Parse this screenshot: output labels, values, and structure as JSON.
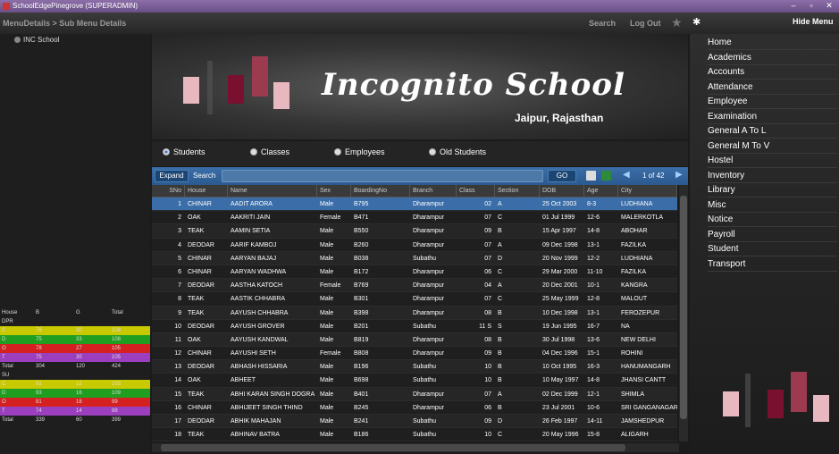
{
  "titlebar": {
    "title": "SchoolEdgePinegrove (SUPERADMIN)",
    "minimize": "–",
    "restore": "▫",
    "close": "✕"
  },
  "topbar": {
    "breadcrumb": "MenuDetails > Sub Menu Details",
    "search": "Search",
    "logout": "Log Out",
    "hide_menu": "Hide Menu"
  },
  "tree": {
    "root": "INC School"
  },
  "stats": {
    "header": [
      "House",
      "B",
      "G",
      "Total"
    ],
    "rows": [
      {
        "c": [
          "DPR",
          "",
          "",
          ""
        ],
        "color": ""
      },
      {
        "c": [
          "C",
          "76",
          "30",
          "106"
        ],
        "color": "#c9c900"
      },
      {
        "c": [
          "D",
          "75",
          "33",
          "108"
        ],
        "color": "#1f9e1f"
      },
      {
        "c": [
          "O",
          "78",
          "27",
          "105"
        ],
        "color": "#d42020"
      },
      {
        "c": [
          "T",
          "75",
          "30",
          "105"
        ],
        "color": "#9b3fbf"
      },
      {
        "c": [
          "Total",
          "304",
          "120",
          "424"
        ],
        "color": ""
      },
      {
        "c": [
          "SU",
          "",
          "",
          ""
        ],
        "color": ""
      },
      {
        "c": [
          "C",
          "91",
          "12",
          "103"
        ],
        "color": "#c9c900"
      },
      {
        "c": [
          "D",
          "93",
          "16",
          "109"
        ],
        "color": "#1f9e1f"
      },
      {
        "c": [
          "O",
          "81",
          "18",
          "99"
        ],
        "color": "#d42020"
      },
      {
        "c": [
          "T",
          "74",
          "14",
          "88"
        ],
        "color": "#9b3fbf"
      },
      {
        "c": [
          "Total",
          "339",
          "60",
          "399"
        ],
        "color": ""
      }
    ]
  },
  "banner": {
    "school_name": "Incognito School",
    "city": "Jaipur, Rajasthan"
  },
  "radios": {
    "students": "Students",
    "classes": "Classes",
    "employees": "Employees",
    "old_students": "Old Students",
    "selected": "students"
  },
  "toolbar": {
    "expand": "Expand",
    "search": "Search",
    "search_value": "",
    "go": "GO",
    "page_info": "1 of 42"
  },
  "grid": {
    "columns": [
      "SNo",
      "House",
      "Name",
      "Sex",
      "BoardingNo",
      "Branch",
      "Class",
      "Section",
      "DOB",
      "Age",
      "City"
    ],
    "rows": [
      [
        "1",
        "CHINAR",
        "AADIT ARORA",
        "Male",
        "B795",
        "Dharampur",
        "02",
        "A",
        "25 Oct 2003",
        "8-3",
        "LUDHIANA"
      ],
      [
        "2",
        "OAK",
        "AAKRITI JAIN",
        "Female",
        "B471",
        "Dharampur",
        "07",
        "C",
        "01 Jul 1999",
        "12-6",
        "MALERKOTLA"
      ],
      [
        "3",
        "TEAK",
        "AAMIN SETIA",
        "Male",
        "B550",
        "Dharampur",
        "09",
        "B",
        "15 Apr 1997",
        "14-8",
        "ABOHAR"
      ],
      [
        "4",
        "DEODAR",
        "AARIF KAMBOJ",
        "Male",
        "B260",
        "Dharampur",
        "07",
        "A",
        "09 Dec 1998",
        "13-1",
        "FAZILKA"
      ],
      [
        "5",
        "CHINAR",
        "AARYAN BAJAJ",
        "Male",
        "B038",
        "Subathu",
        "07",
        "D",
        "20 Nov 1999",
        "12-2",
        "LUDHIANA"
      ],
      [
        "6",
        "CHINAR",
        "AARYAN WADHWA",
        "Male",
        "B172",
        "Dharampur",
        "06",
        "C",
        "29 Mar 2000",
        "11-10",
        "FAZILKA"
      ],
      [
        "7",
        "DEODAR",
        "AASTHA KATOCH",
        "Female",
        "B769",
        "Dharampur",
        "04",
        "A",
        "20 Dec 2001",
        "10-1",
        "KANGRA"
      ],
      [
        "8",
        "TEAK",
        "AASTIK CHHABRA",
        "Male",
        "B301",
        "Dharampur",
        "07",
        "C",
        "25 May 1999",
        "12-8",
        "MALOUT"
      ],
      [
        "9",
        "TEAK",
        "AAYUSH CHHABRA",
        "Male",
        "B398",
        "Dharampur",
        "08",
        "B",
        "10 Dec 1998",
        "13-1",
        "FEROZEPUR"
      ],
      [
        "10",
        "DEODAR",
        "AAYUSH GROVER",
        "Male",
        "B201",
        "Subathu",
        "11 S",
        "S",
        "19 Jun 1995",
        "16-7",
        "NA"
      ],
      [
        "11",
        "OAK",
        "AAYUSH KANDWAL",
        "Male",
        "B819",
        "Dharampur",
        "08",
        "B",
        "30 Jul 1998",
        "13-6",
        "NEW DELHI"
      ],
      [
        "12",
        "CHINAR",
        "AAYUSHI SETH",
        "Female",
        "B808",
        "Dharampur",
        "09",
        "B",
        "04 Dec 1996",
        "15-1",
        "ROHINI"
      ],
      [
        "13",
        "DEODAR",
        "ABHASH HISSARIA",
        "Male",
        "B196",
        "Subathu",
        "10",
        "B",
        "10 Oct 1995",
        "16-3",
        "HANUMANGARH"
      ],
      [
        "14",
        "OAK",
        "ABHEET",
        "Male",
        "B698",
        "Subathu",
        "10",
        "B",
        "10 May 1997",
        "14-8",
        "JHANSI CANTT"
      ],
      [
        "15",
        "TEAK",
        "ABHI KARAN SINGH DOGRA",
        "Male",
        "B401",
        "Dharampur",
        "07",
        "A",
        "02 Dec 1999",
        "12-1",
        "SHIMLA"
      ],
      [
        "16",
        "CHINAR",
        "ABHIJEET SINGH THIND",
        "Male",
        "B245",
        "Dharampur",
        "06",
        "B",
        "23 Jul 2001",
        "10-6",
        "SRI GANGANAGAR"
      ],
      [
        "17",
        "DEODAR",
        "ABHIK MAHAJAN",
        "Male",
        "B241",
        "Subathu",
        "09",
        "D",
        "26 Feb 1997",
        "14-11",
        "JAMSHEDPUR"
      ],
      [
        "18",
        "TEAK",
        "ABHINAV BATRA",
        "Male",
        "B186",
        "Subathu",
        "10",
        "C",
        "20 May 1996",
        "15-8",
        "ALIGARH"
      ]
    ]
  },
  "menu": {
    "items": [
      "Home",
      "Academics",
      "Accounts",
      "Attendance",
      "Employee",
      "Examination",
      "General A To L",
      "General M To V",
      "Hostel",
      "Inventory",
      "Library",
      "Misc",
      "Notice",
      "Payroll",
      "Student",
      "Transport"
    ]
  },
  "colors": {
    "accent": "#3b6ea8",
    "titlebar": "#7a5e98",
    "bar_pink": "#e8b8c0",
    "bar_maroon": "#7a1030"
  },
  "icons": {
    "star": "★",
    "gear": "✱",
    "prev": "◀",
    "next": "▶"
  }
}
